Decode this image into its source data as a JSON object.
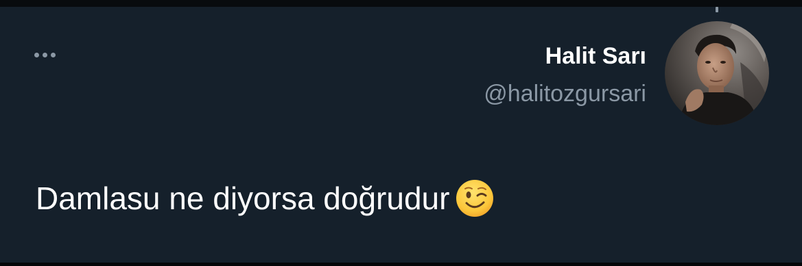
{
  "tweet": {
    "author": {
      "display_name": "Halit Sarı",
      "handle": "@halitozgursari"
    },
    "text": "Damlasu ne diyorsa doğrudur",
    "emoji": "winking-face",
    "more_icon": "more-horizontal-icon"
  },
  "colors": {
    "background": "#15202b",
    "text_primary": "#ffffff",
    "text_secondary": "#8b98a5"
  }
}
